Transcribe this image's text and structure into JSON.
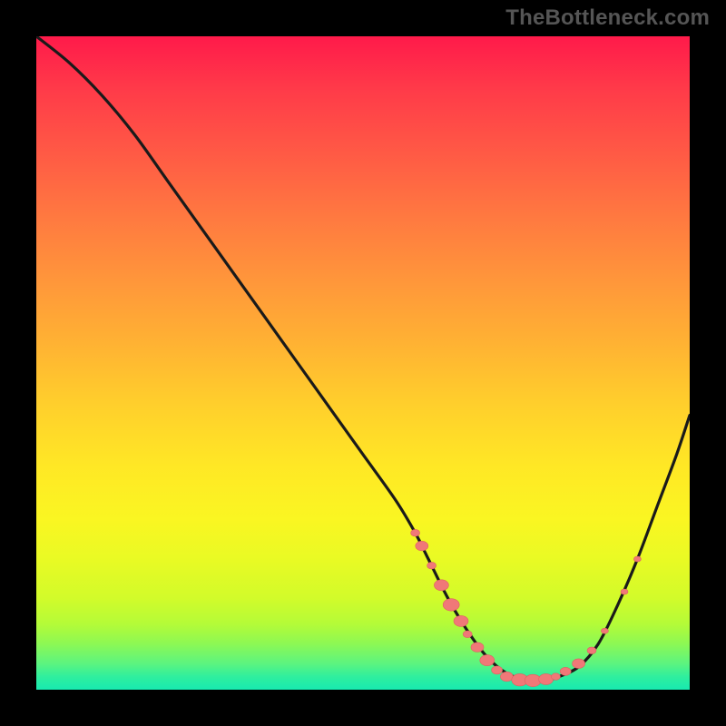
{
  "watermark": "TheBottleneck.com",
  "colors": {
    "page_bg": "#000000",
    "watermark": "#555555",
    "curve_stroke": "#1a1a1a",
    "marker_fill": "#f07878",
    "marker_stroke": "#e06060"
  },
  "chart_data": {
    "type": "line",
    "title": "",
    "xlabel": "",
    "ylabel": "",
    "xlim": [
      0,
      100
    ],
    "ylim": [
      0,
      100
    ],
    "grid": false,
    "legend": false,
    "series": [
      {
        "name": "bottleneck-curve",
        "x": [
          0,
          5,
          10,
          15,
          20,
          25,
          30,
          35,
          40,
          45,
          50,
          55,
          58,
          60,
          63,
          66,
          69,
          72,
          75,
          78,
          80,
          83,
          86,
          89,
          92,
          95,
          98,
          100
        ],
        "y": [
          100,
          96,
          91,
          85,
          78,
          71,
          64,
          57,
          50,
          43,
          36,
          29,
          24,
          20,
          14,
          9,
          5,
          2.5,
          1.5,
          1.5,
          2,
          3.5,
          7,
          13,
          20,
          28,
          36,
          42
        ],
        "note": "y is relative height of the dip curve; 0 = bottom of gradient, 100 = top"
      }
    ],
    "markers": [
      {
        "x": 58,
        "y": 24,
        "size": 5
      },
      {
        "x": 59,
        "y": 22,
        "size": 7
      },
      {
        "x": 60.5,
        "y": 19,
        "size": 5
      },
      {
        "x": 62,
        "y": 16,
        "size": 8
      },
      {
        "x": 63.5,
        "y": 13,
        "size": 9
      },
      {
        "x": 65,
        "y": 10.5,
        "size": 8
      },
      {
        "x": 66,
        "y": 8.5,
        "size": 5
      },
      {
        "x": 67.5,
        "y": 6.5,
        "size": 7
      },
      {
        "x": 69,
        "y": 4.5,
        "size": 8
      },
      {
        "x": 70.5,
        "y": 3,
        "size": 6
      },
      {
        "x": 72,
        "y": 2,
        "size": 7
      },
      {
        "x": 74,
        "y": 1.5,
        "size": 9
      },
      {
        "x": 76,
        "y": 1.4,
        "size": 9
      },
      {
        "x": 78,
        "y": 1.6,
        "size": 8
      },
      {
        "x": 79.5,
        "y": 2,
        "size": 5
      },
      {
        "x": 81,
        "y": 2.8,
        "size": 6
      },
      {
        "x": 83,
        "y": 4,
        "size": 7
      },
      {
        "x": 85,
        "y": 6,
        "size": 5
      },
      {
        "x": 87,
        "y": 9,
        "size": 4
      },
      {
        "x": 90,
        "y": 15,
        "size": 4
      },
      {
        "x": 92,
        "y": 20,
        "size": 4
      }
    ]
  }
}
